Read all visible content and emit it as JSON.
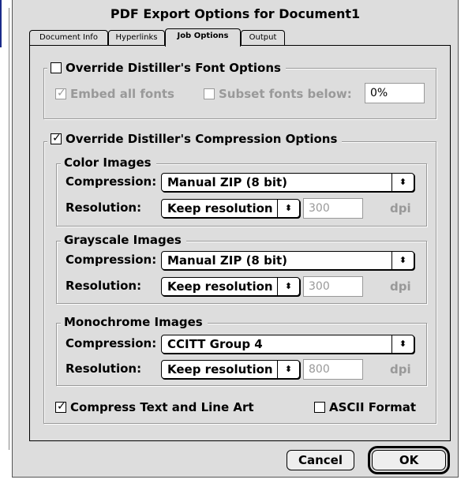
{
  "window": {
    "title": "PDF Export Options for Document1"
  },
  "tabs": [
    {
      "label": "Document Info"
    },
    {
      "label": "Hyperlinks"
    },
    {
      "label": "Job Options"
    },
    {
      "label": "Output"
    }
  ],
  "font_options": {
    "override_label": "Override Distiller's Font Options",
    "override_checked": false,
    "embed_label": "Embed all fonts",
    "embed_checked": true,
    "subset_label": "Subset fonts below:",
    "subset_checked": false,
    "subset_value": "0%"
  },
  "compression_options": {
    "override_label": "Override Distiller's Compression Options",
    "override_checked": true,
    "color": {
      "title": "Color Images",
      "compression_label": "Compression:",
      "compression_value": "Manual ZIP (8 bit)",
      "resolution_label": "Resolution:",
      "resolution_value": "Keep resolution",
      "dpi_value": "300",
      "dpi_unit": "dpi"
    },
    "grayscale": {
      "title": "Grayscale Images",
      "compression_label": "Compression:",
      "compression_value": "Manual ZIP (8 bit)",
      "resolution_label": "Resolution:",
      "resolution_value": "Keep resolution",
      "dpi_value": "300",
      "dpi_unit": "dpi"
    },
    "monochrome": {
      "title": "Monochrome Images",
      "compression_label": "Compression:",
      "compression_value": "CCITT Group 4",
      "resolution_label": "Resolution:",
      "resolution_value": "Keep resolution",
      "dpi_value": "800",
      "dpi_unit": "dpi"
    },
    "compress_text_label": "Compress Text and Line Art",
    "compress_text_checked": true,
    "ascii_label": "ASCII Format",
    "ascii_checked": false
  },
  "buttons": {
    "cancel": "Cancel",
    "ok": "OK"
  },
  "glyphs": {
    "check": "✓",
    "popup_arrow": "⬍"
  }
}
